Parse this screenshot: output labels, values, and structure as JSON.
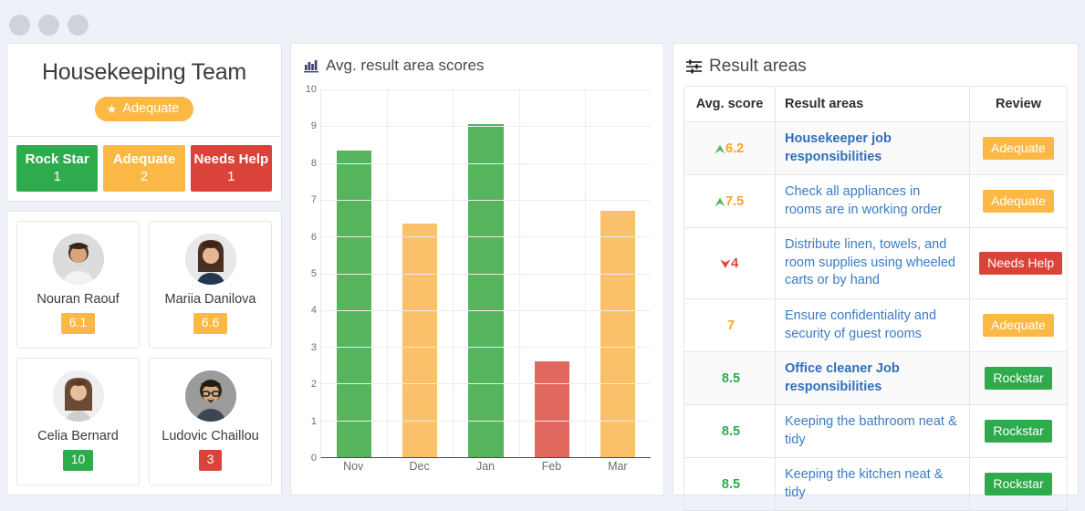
{
  "window": {
    "dots": [
      "close-dot",
      "minimize-dot",
      "maximize-dot"
    ]
  },
  "team": {
    "title": "Housekeeping Team",
    "rating_pill": {
      "label": "Adequate",
      "icon": "star-icon",
      "color": "#fbb844"
    },
    "stats": [
      {
        "label": "Rock Star",
        "count": "1",
        "color": "#2eab4d"
      },
      {
        "label": "Adequate",
        "count": "2",
        "color": "#fbb844"
      },
      {
        "label": "Needs Help",
        "count": "1",
        "color": "#d9433a"
      }
    ],
    "members": [
      {
        "name": "Nouran Raouf",
        "score": "6.1",
        "score_color": "#fbb844",
        "tone": "orange"
      },
      {
        "name": "Mariia Danilova",
        "score": "6.6",
        "score_color": "#fbb844",
        "tone": "orange"
      },
      {
        "name": "Celia Bernard",
        "score": "10",
        "score_color": "#2eab4d",
        "tone": "green"
      },
      {
        "name": "Ludovic Chaillou",
        "score": "3",
        "score_color": "#d9433a",
        "tone": "red"
      }
    ]
  },
  "chart_panel": {
    "title": "Avg. result area scores",
    "icon": "bar-chart-icon"
  },
  "chart_data": {
    "type": "bar",
    "title": "Avg. result area scores",
    "categories": [
      "Nov",
      "Dec",
      "Jan",
      "Feb",
      "Mar"
    ],
    "values": [
      8.35,
      6.35,
      9.05,
      2.6,
      6.7
    ],
    "bar_colors": [
      "#56b45d",
      "#fbc06a",
      "#56b45d",
      "#e0685f",
      "#fbc06a"
    ],
    "xlabel": "",
    "ylabel": "",
    "ylim": [
      0,
      10
    ],
    "yticks": [
      "10",
      "9",
      "8",
      "7",
      "6",
      "5",
      "4",
      "3",
      "2",
      "1",
      "0"
    ],
    "grid": true,
    "legend": "none"
  },
  "result_areas": {
    "title": "Result areas",
    "icon": "sliders-icon",
    "columns": [
      "Avg. score",
      "Result areas",
      "Review"
    ],
    "rows": [
      {
        "trend": "up",
        "score": "6.2",
        "score_tone": "c-orange",
        "name": "Housekeeper job responsibilities",
        "bold": true,
        "review": "Adequate",
        "review_tone": "orange",
        "alt": true
      },
      {
        "trend": "up",
        "score": "7.5",
        "score_tone": "c-orange",
        "name": "Check all appliances in rooms are in working order",
        "bold": false,
        "review": "Adequate",
        "review_tone": "orange",
        "alt": false
      },
      {
        "trend": "down",
        "score": "4",
        "score_tone": "c-red",
        "name": "Distribute linen, towels, and room supplies using wheeled carts or by hand",
        "bold": false,
        "review": "Needs Help",
        "review_tone": "red",
        "alt": false
      },
      {
        "trend": "none",
        "score": "7",
        "score_tone": "c-orange",
        "name": "Ensure confidentiality and security of guest rooms",
        "bold": false,
        "review": "Adequate",
        "review_tone": "orange",
        "alt": false
      },
      {
        "trend": "none",
        "score": "8.5",
        "score_tone": "c-green",
        "name": "Office cleaner Job responsibilities",
        "bold": true,
        "review": "Rockstar",
        "review_tone": "green",
        "alt": true
      },
      {
        "trend": "none",
        "score": "8.5",
        "score_tone": "c-green",
        "name": "Keeping the bathroom neat & tidy",
        "bold": false,
        "review": "Rockstar",
        "review_tone": "green",
        "alt": false
      },
      {
        "trend": "none",
        "score": "8.5",
        "score_tone": "c-green",
        "name": "Keeping the kitchen neat & tidy",
        "bold": false,
        "review": "Rockstar",
        "review_tone": "green",
        "alt": false
      }
    ]
  }
}
